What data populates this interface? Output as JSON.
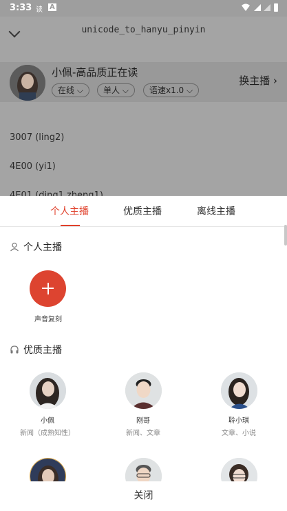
{
  "status_bar": {
    "time": "3:33",
    "icons": [
      "读",
      "A"
    ]
  },
  "background_page": {
    "title": "unicode_to_hanyu_pinyin",
    "voice": {
      "name": "小佩-高品质正在读",
      "chips": [
        "在线 ⌵",
        "单人 ⌵",
        "语速x1.0 ⌵"
      ],
      "switch_label": "换主播 ›"
    },
    "lines": [
      "3007 (ling2)",
      "4E00 (yi1)",
      "4E01 (ding1,zheng1)"
    ]
  },
  "sheet": {
    "tabs": [
      {
        "label": "个人主播",
        "active": true
      },
      {
        "label": "优质主播",
        "active": false
      },
      {
        "label": "离线主播",
        "active": false
      }
    ],
    "personal_section": {
      "title": "个人主播",
      "clone_label": "声音复刻"
    },
    "quality_section": {
      "title": "优质主播",
      "anchors": [
        {
          "name": "小佩",
          "desc": "新闻（成熟知性）"
        },
        {
          "name": "刚哥",
          "desc": "新闻、文章"
        },
        {
          "name": "聆小琪",
          "desc": "文章、小说"
        }
      ]
    },
    "close_label": "关闭"
  },
  "colors": {
    "accent": "#e0402b",
    "overlay": "#a4a4a4"
  }
}
